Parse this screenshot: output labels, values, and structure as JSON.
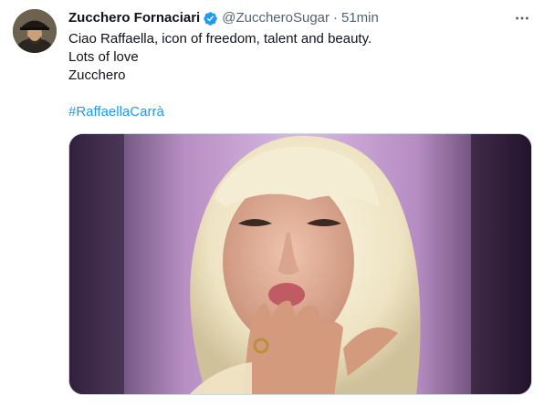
{
  "tweet": {
    "display_name": "Zucchero Fornaciari",
    "handle": "@ZuccheroSugar",
    "separator": "·",
    "time": "51min",
    "more_icon": "more-horizontal-icon",
    "verified_icon": "verified-badge-icon",
    "text_lines": [
      "Ciao Raffaella, icon of freedom, talent and beauty.",
      "Lots of love",
      "Zucchero"
    ],
    "hashtag": "#RaffaellaCarrà"
  },
  "colors": {
    "accent": "#1d9bf0",
    "secondary_text": "#536471",
    "primary_text": "#0f1419"
  }
}
